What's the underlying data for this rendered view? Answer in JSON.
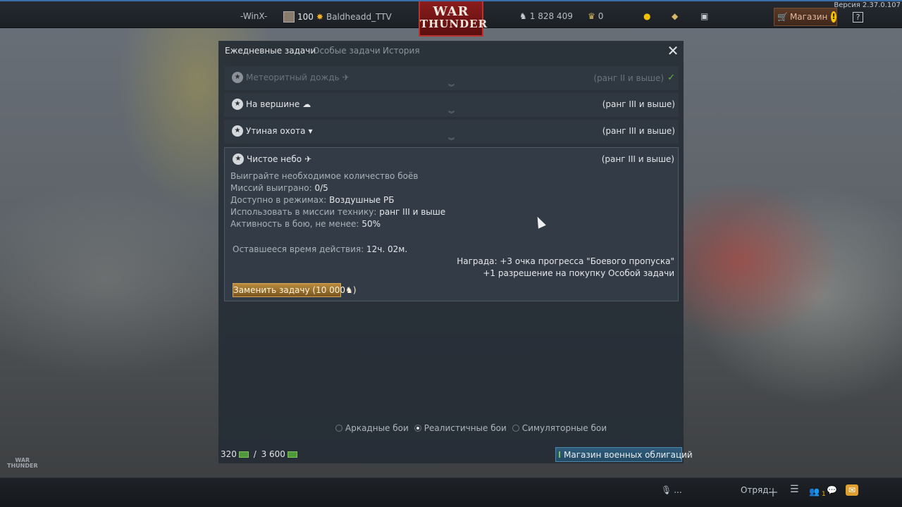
{
  "version": "Версия 2.37.0.107",
  "topbar": {
    "squad": "-WinX-",
    "level": "100",
    "nickname": "Baldheadd_TTV",
    "logo_line1": "WAR",
    "logo_line2": "THUNDER",
    "silver_lions": "1 828 409",
    "golden_eagles": "0",
    "shop_label": "Магазин",
    "help_label": "?",
    "icons": [
      "lion-icon",
      "eagle-icon",
      "lightbulb-icon",
      "diamond-icon",
      "ticket-icon",
      "cart-icon",
      "alert-icon",
      "help-icon"
    ]
  },
  "window": {
    "tabs": [
      {
        "label": "Ежедневные задачи",
        "active": true
      },
      {
        "label": "Особые задачи",
        "active": false
      },
      {
        "label": "История",
        "active": false
      }
    ],
    "close_label": "✕",
    "tasks": [
      {
        "title": "Метеоритный дождь",
        "vehicle_icon": "plane-icon",
        "rank": "(ранг II и выше)",
        "done": true
      },
      {
        "title": "На вершине",
        "vehicle_icon": "cloud-icon",
        "rank": "(ранг III и выше)",
        "done": false
      },
      {
        "title": "Утиная охота",
        "vehicle_icon": "bomb-icon",
        "rank": "(ранг III и выше)",
        "done": false
      }
    ],
    "open_task": {
      "title": "Чистое небо",
      "vehicle_icon": "plane-icon",
      "rank": "(ранг III и выше)",
      "description": "Выиграйте необходимое количество боёв",
      "missions_label": "Миссий выиграно:",
      "missions_value": "0/5",
      "modes_label": "Доступно в режимах:",
      "modes_value": "Воздушные РБ",
      "vehicles_label": "Использовать в миссии технику:",
      "vehicles_value": "ранг III и выше",
      "activity_label": "Активность в бою, не менее:",
      "activity_value": "50%",
      "time_label": "Оставшееся время действия:",
      "time_value": "12ч. 02м.",
      "reward_line1": "Награда: +3 очка прогресса \"Боевого пропуска\"",
      "reward_line2": "+1 разрешение на покупку Особой задачи",
      "replace_button": "Заменить задачу (10 000"
    },
    "modes": [
      {
        "label": "Аркадные бои",
        "selected": false
      },
      {
        "label": "Реалистичные бои",
        "selected": true
      },
      {
        "label": "Симуляторные бои",
        "selected": false
      }
    ],
    "bonds_current": "320",
    "bonds_max": "3 600",
    "bonds_shop": "Магазин военных облигаций"
  },
  "bottombar": {
    "voice": "...",
    "squad_label": "Отряд:",
    "friends_count": "1"
  },
  "watermark_line1": "WAR",
  "watermark_line2": "THUNDER"
}
